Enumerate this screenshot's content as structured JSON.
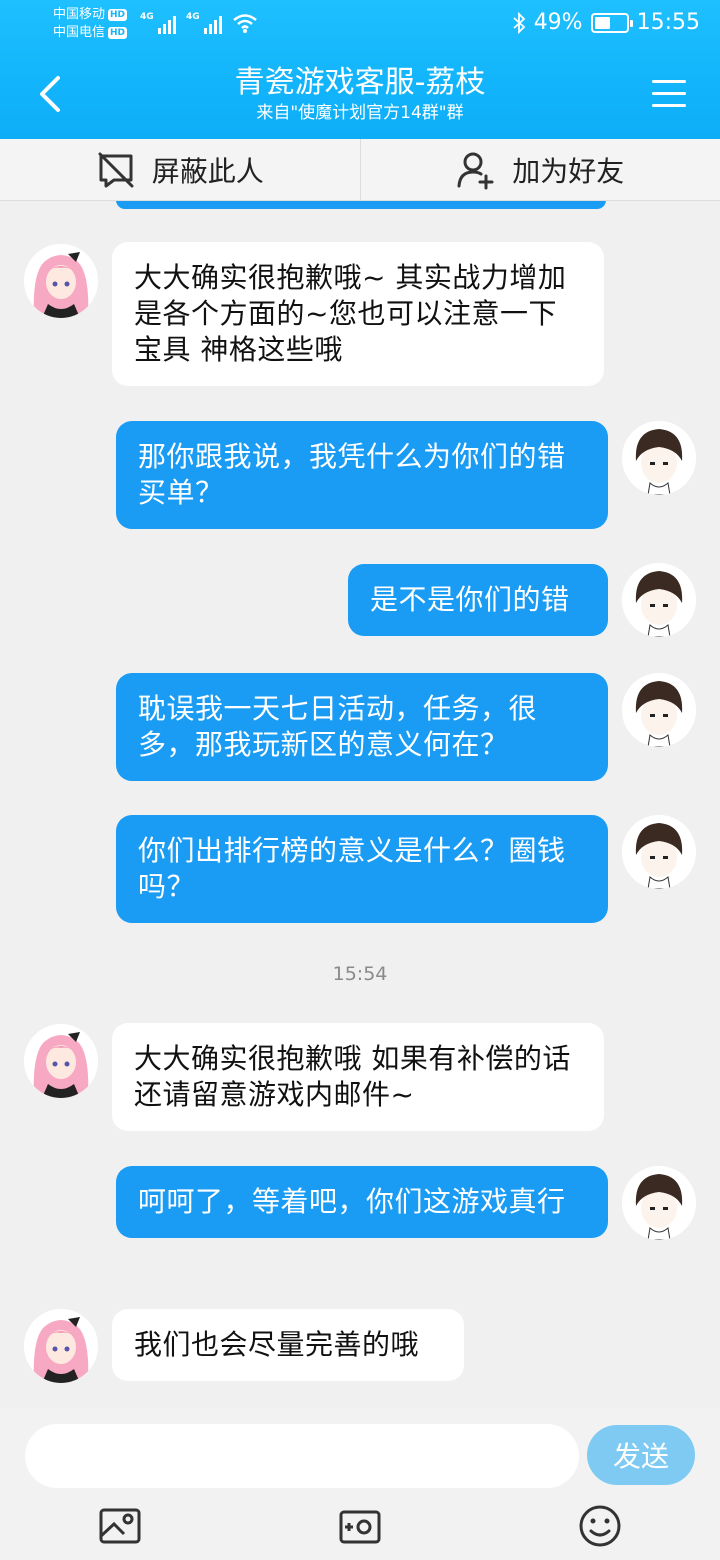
{
  "status_bar": {
    "carrier1": "中国移动",
    "carrier2": "中国电信",
    "hd_badge": "HD",
    "network1": "4G",
    "network2": "4G",
    "battery_percent": "49%",
    "battery_level": 0.49,
    "time": "15:55"
  },
  "header": {
    "title": "青瓷游戏客服-荔枝",
    "subtitle": "来自\"使魔计划官方14群\"群",
    "back_icon": "chevron-left-icon",
    "menu_icon": "hamburger-menu-icon"
  },
  "actions": {
    "block_label": "屏蔽此人",
    "add_friend_label": "加为好友"
  },
  "chat": {
    "messages": [
      {
        "side": "left",
        "text": "大大确实很抱歉哦~ 其实战力增加是各个方面的~您也可以注意一下宝具 神格这些哦"
      },
      {
        "side": "right",
        "text": "那你跟我说，我凭什么为你们的错买单？"
      },
      {
        "side": "right",
        "text": "是不是你们的错"
      },
      {
        "side": "right",
        "text": "耽误我一天七日活动，任务，很多，那我玩新区的意义何在？"
      },
      {
        "side": "right",
        "text": "你们出排行榜的意义是什么？圈钱吗？"
      },
      {
        "side": "left",
        "text": "大大确实很抱歉哦  如果有补偿的话  还请留意游戏内邮件~"
      },
      {
        "side": "right",
        "text": "呵呵了，等着吧，你们这游戏真行"
      },
      {
        "side": "left",
        "text": "我们也会尽量完善的哦"
      }
    ],
    "timestamp": "15:54"
  },
  "input_bar": {
    "placeholder": "",
    "send_label": "发送",
    "tools": [
      "image-icon",
      "camera-icon",
      "emoji-icon"
    ]
  },
  "colors": {
    "header": "#14b6fb",
    "bubble_self": "#1a9cf5",
    "send_button": "#7fcaf3"
  }
}
